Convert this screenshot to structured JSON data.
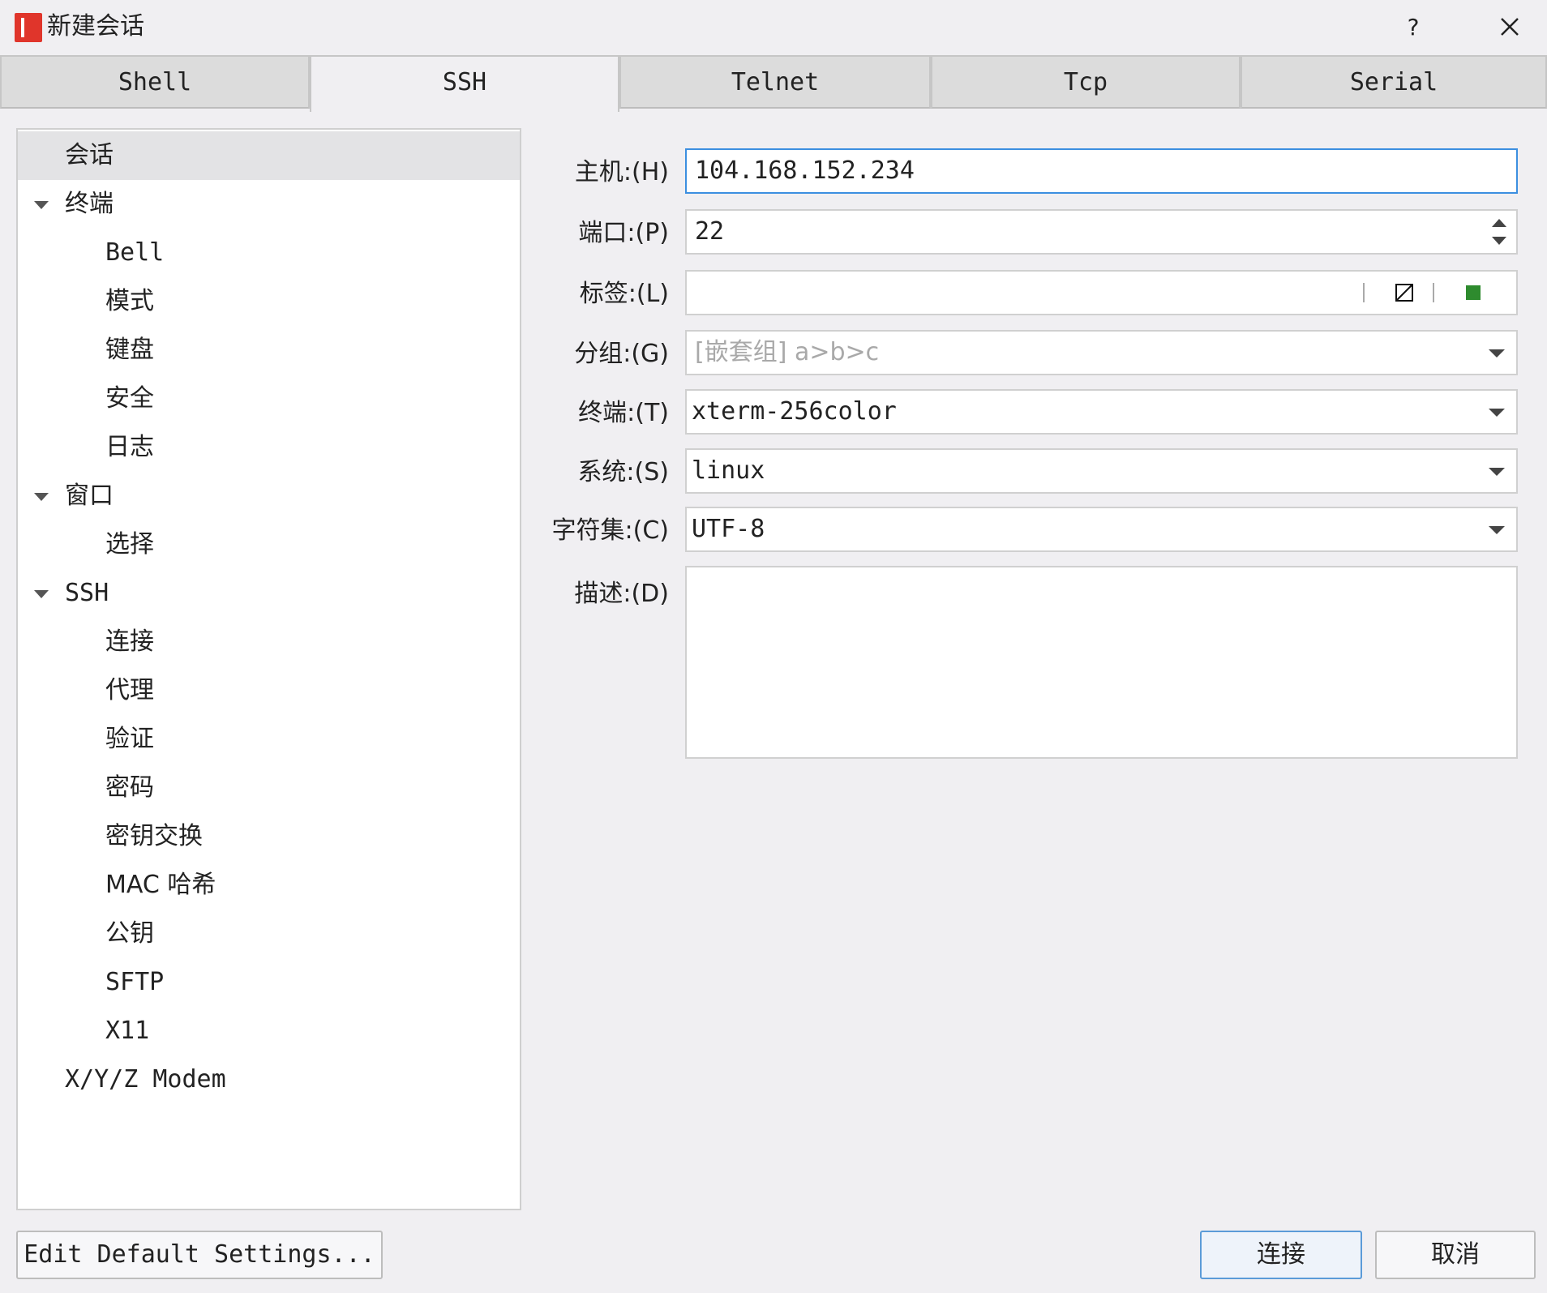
{
  "window": {
    "title": "新建会话",
    "help_label": "?"
  },
  "icons": {
    "app": "app-logo-icon",
    "close": "close-icon"
  },
  "tabs": [
    {
      "label": "Shell"
    },
    {
      "label": "SSH"
    },
    {
      "label": "Telnet"
    },
    {
      "label": "Tcp"
    },
    {
      "label": "Serial"
    }
  ],
  "active_tab": "SSH",
  "tree": {
    "items": [
      {
        "label": "会话",
        "level": 0,
        "expandable": false,
        "selected": true
      },
      {
        "label": "终端",
        "level": 0,
        "expandable": true
      },
      {
        "label": "Bell",
        "level": 1
      },
      {
        "label": "模式",
        "level": 1
      },
      {
        "label": "键盘",
        "level": 1
      },
      {
        "label": "安全",
        "level": 1
      },
      {
        "label": "日志",
        "level": 1
      },
      {
        "label": "窗口",
        "level": 0,
        "expandable": true
      },
      {
        "label": "选择",
        "level": 1
      },
      {
        "label": "SSH",
        "level": 0,
        "expandable": true
      },
      {
        "label": "连接",
        "level": 1
      },
      {
        "label": "代理",
        "level": 1
      },
      {
        "label": "验证",
        "level": 1
      },
      {
        "label": "密码",
        "level": 1
      },
      {
        "label": "密钥交换",
        "level": 1
      },
      {
        "label": "MAC 哈希",
        "level": 1
      },
      {
        "label": "公钥",
        "level": 1
      },
      {
        "label": "SFTP",
        "level": 1
      },
      {
        "label": "X11",
        "level": 1
      },
      {
        "label": "X/Y/Z Modem",
        "level": 0,
        "expandable": false
      }
    ]
  },
  "form": {
    "host": {
      "label": "主机:(H)",
      "value": "104.168.152.234"
    },
    "port": {
      "label": "端口:(P)",
      "value": "22"
    },
    "tag": {
      "label": "标签:(L)",
      "value": "",
      "color_swatch": "#2e8b2e"
    },
    "group": {
      "label": "分组:(G)",
      "placeholder": "[嵌套组] a>b>c"
    },
    "terminal": {
      "label": "终端:(T)",
      "value": "xterm-256color"
    },
    "system": {
      "label": "系统:(S)",
      "value": "linux"
    },
    "charset": {
      "label": "字符集:(C)",
      "value": "UTF-8"
    },
    "description": {
      "label": "描述:(D)",
      "value": ""
    }
  },
  "buttons": {
    "edit_defaults": "Edit Default Settings...",
    "connect": "连接",
    "cancel": "取消"
  },
  "colors": {
    "accent": "#3c8fe0",
    "app_icon_red": "#e0352b",
    "tag_green": "#2e8b2e"
  }
}
